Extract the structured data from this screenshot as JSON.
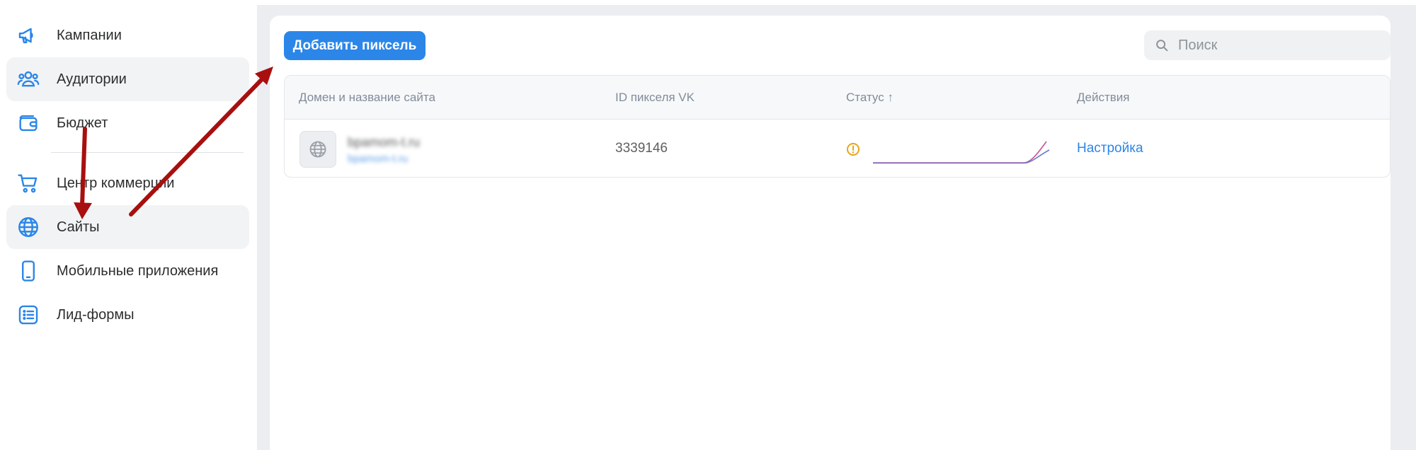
{
  "sidebar": {
    "items": [
      {
        "label": "Кампании",
        "icon": "megaphone-icon",
        "active": false
      },
      {
        "label": "Аудитории",
        "icon": "users-icon",
        "active": true
      },
      {
        "label": "Бюджет",
        "icon": "wallet-icon",
        "active": false
      },
      {
        "label": "Центр коммерции",
        "icon": "cart-icon",
        "active": false
      },
      {
        "label": "Сайты",
        "icon": "globe-icon",
        "active": true
      },
      {
        "label": "Мобильные приложения",
        "icon": "smartphone-icon",
        "active": false
      },
      {
        "label": "Лид-формы",
        "icon": "list-form-icon",
        "active": false
      }
    ]
  },
  "toolbar": {
    "add_pixel_label": "Добавить пиксель"
  },
  "search": {
    "placeholder": "Поиск",
    "value": ""
  },
  "table": {
    "columns": [
      "Домен и название сайта",
      "ID пикселя VK",
      "Статус ↑",
      "Действия"
    ],
    "rows": [
      {
        "site_name": "bpamom-t.ru",
        "site_url": "bpamom-t.ru",
        "pixel_id": "3339146",
        "status_icon": "warning-circle-icon",
        "action": "Настройка"
      }
    ]
  },
  "colors": {
    "accent": "#2b86e8",
    "warning": "#e8a51a",
    "annotation_arrow": "#a80f0f",
    "sparkline_primary": "#6a7bd1",
    "sparkline_secondary": "#c25594"
  }
}
